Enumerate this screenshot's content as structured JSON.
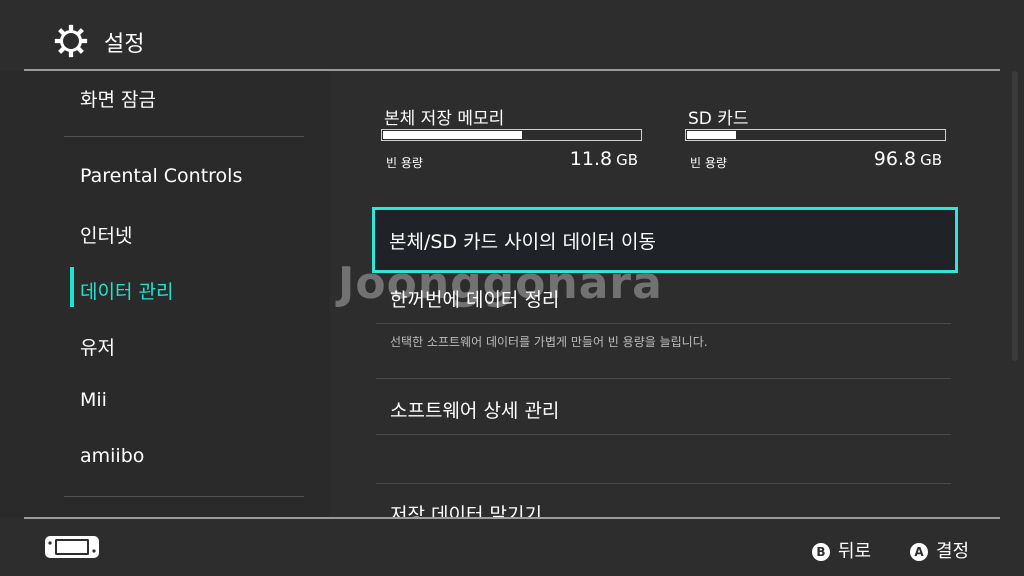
{
  "header": {
    "title": "설정",
    "icon": "gear-icon"
  },
  "sidebar": {
    "items": [
      {
        "label": "화면 잠금"
      },
      {
        "label": "Parental Controls"
      },
      {
        "label": "인터넷"
      },
      {
        "label": "데이터 관리",
        "selected": true
      },
      {
        "label": "유저"
      },
      {
        "label": "Mii"
      },
      {
        "label": "amiibo"
      }
    ]
  },
  "storage": {
    "system": {
      "label": "본체 저장 메모리",
      "free_label": "빈 용량",
      "free_value": "11.8",
      "unit": "GB",
      "used_fraction": 0.54
    },
    "sd": {
      "label": "SD 카드",
      "free_label": "빈 용량",
      "free_value": "96.8",
      "unit": "GB",
      "used_fraction": 0.19
    }
  },
  "menu": {
    "move_data": "본체/SD 카드 사이의 데이터 이동",
    "cleanup": "한꺼번에 데이터 정리",
    "cleanup_desc": "선택한 소프트웨어 데이터를 가볍게 만들어 빈 용량을 늘립니다.",
    "software_manage": "소프트웨어 상세 관리",
    "save_data": "저장 데이터 맡기기"
  },
  "watermark": "Joonggonara",
  "footer": {
    "back_button": "B",
    "back_label": "뒤로",
    "ok_button": "A",
    "ok_label": "결정"
  },
  "colors": {
    "accent": "#19e6d2",
    "background": "#2d2d2d",
    "focus_border": "#2fe6d9"
  }
}
